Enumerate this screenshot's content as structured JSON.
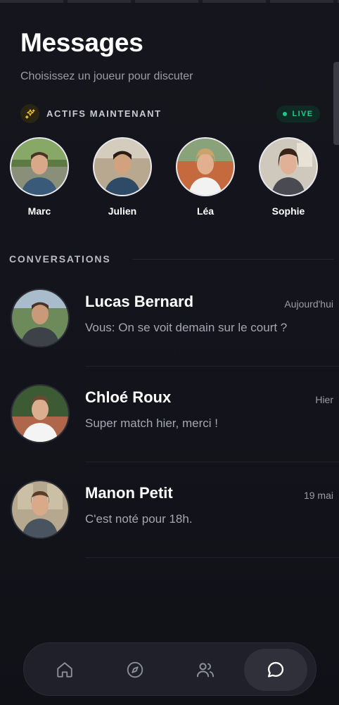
{
  "header": {
    "title": "Messages",
    "subtitle": "Choisissez un joueur pour discuter"
  },
  "active": {
    "label": "ACTIFS MAINTENANT",
    "live_badge": "LIVE",
    "spark_icon": "sparkles-icon",
    "players": [
      {
        "name": "Marc"
      },
      {
        "name": "Julien"
      },
      {
        "name": "Léa"
      },
      {
        "name": "Sophie"
      }
    ]
  },
  "conversations": {
    "label": "CONVERSATIONS",
    "items": [
      {
        "name": "Lucas Bernard",
        "time": "Aujourd'hui",
        "message": "Vous: On se voit demain sur le court ?"
      },
      {
        "name": "Chloé Roux",
        "time": "Hier",
        "message": "Super match hier, merci !"
      },
      {
        "name": "Manon Petit",
        "time": "19 mai",
        "message": "C'est noté pour 18h."
      }
    ]
  },
  "nav": {
    "items": [
      {
        "icon": "home-icon"
      },
      {
        "icon": "compass-icon"
      },
      {
        "icon": "users-icon"
      },
      {
        "icon": "chat-icon",
        "active": true
      }
    ]
  },
  "colors": {
    "background": "#12131a",
    "live_green": "#22c98a",
    "spark_yellow": "#f2c230",
    "muted_text": "#9a9ca8"
  }
}
